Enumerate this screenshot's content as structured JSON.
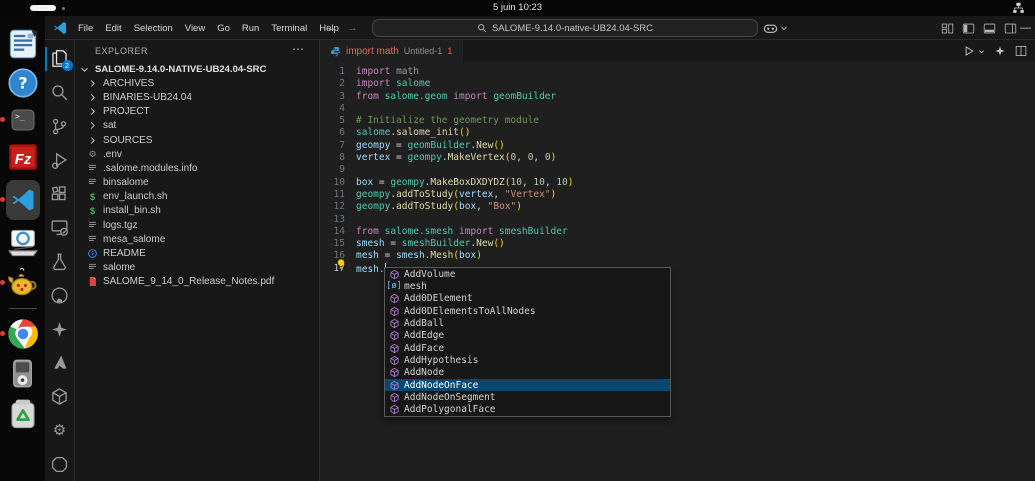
{
  "system": {
    "clock": "5 juin 10:23"
  },
  "colors": {
    "accent": "#0078d4",
    "list_selection": "#094771",
    "error": "#e5695f"
  },
  "dock": {
    "items": [
      {
        "name": "libreoffice-writer"
      },
      {
        "name": "help"
      },
      {
        "name": "terminal",
        "notification": true
      },
      {
        "name": "filezilla"
      },
      {
        "name": "vscode",
        "notification": true,
        "active": true
      },
      {
        "name": "cad-viewer"
      },
      {
        "name": "teapot-app",
        "notification": true
      },
      {
        "type": "separator"
      },
      {
        "name": "chrome",
        "notification": true
      },
      {
        "name": "media-player"
      },
      {
        "name": "trash"
      }
    ]
  },
  "titlebar": {
    "menus": [
      "File",
      "Edit",
      "Selection",
      "View",
      "Go",
      "Run",
      "Terminal",
      "Help"
    ],
    "search_value": "SALOME-9.14.0-native-UB24.04-SRC",
    "minimize_glyph": "—"
  },
  "activity_bar": {
    "items": [
      {
        "name": "explorer",
        "active": true,
        "badge": "2"
      },
      {
        "name": "search"
      },
      {
        "name": "source-control"
      },
      {
        "name": "run-debug"
      },
      {
        "name": "extensions"
      },
      {
        "name": "remote-explorer"
      },
      {
        "name": "testing"
      },
      {
        "name": "github"
      },
      {
        "name": "copilot"
      },
      {
        "name": "azure"
      },
      {
        "name": "cube"
      },
      {
        "name": "gear"
      },
      {
        "name": "octagon"
      }
    ]
  },
  "explorer": {
    "header": "EXPLORER",
    "more_actions": "⋯",
    "root": "SALOME-9.14.0-NATIVE-UB24.04-SRC",
    "items": [
      {
        "label": "ARCHIVES",
        "kind": "folder"
      },
      {
        "label": "BINARIES-UB24.04",
        "kind": "folder"
      },
      {
        "label": "PROJECT",
        "kind": "folder"
      },
      {
        "label": "sat",
        "kind": "folder"
      },
      {
        "label": "SOURCES",
        "kind": "folder"
      },
      {
        "label": ".env",
        "kind": "gear"
      },
      {
        "label": ".salome.modules.info",
        "kind": "file"
      },
      {
        "label": "binsalome",
        "kind": "file"
      },
      {
        "label": "env_launch.sh",
        "kind": "shell"
      },
      {
        "label": "install_bin.sh",
        "kind": "shell"
      },
      {
        "label": "logs.tgz",
        "kind": "file"
      },
      {
        "label": "mesa_salome",
        "kind": "file"
      },
      {
        "label": "README",
        "kind": "info"
      },
      {
        "label": "salome",
        "kind": "file"
      },
      {
        "label": "SALOME_9_14_0_Release_Notes.pdf",
        "kind": "pdf"
      }
    ]
  },
  "editor": {
    "tab": {
      "label": "import math",
      "description": "Untitled-1",
      "error_count": "1"
    },
    "code": {
      "token_colors": {
        "kw": "#C586C0",
        "mod": "#4EC9B0",
        "fn": "#DCDCAA",
        "var": "#9CDCFE",
        "num": "#B5CEA8",
        "str": "#CE9178",
        "cmt": "#6A9955",
        "pun": "#D4D4D4",
        "brk": "#FFD700",
        "dim": "#9a9a9a"
      },
      "lines": [
        [
          [
            "kw",
            "import"
          ],
          [
            "pun",
            " "
          ],
          [
            "dim",
            "math"
          ]
        ],
        [
          [
            "kw",
            "import"
          ],
          [
            "pun",
            " "
          ],
          [
            "mod",
            "salome"
          ]
        ],
        [
          [
            "kw",
            "from"
          ],
          [
            "pun",
            " "
          ],
          [
            "mod",
            "salome.geom"
          ],
          [
            "kw",
            " import "
          ],
          [
            "mod",
            "geomBuilder"
          ]
        ],
        [],
        [
          [
            "cmt",
            "# Initialize the geometry module"
          ]
        ],
        [
          [
            "mod",
            "salome"
          ],
          [
            "pun",
            "."
          ],
          [
            "fn",
            "salome_init"
          ],
          [
            "brk",
            "()"
          ]
        ],
        [
          [
            "var",
            "geompy"
          ],
          [
            "pun",
            " = "
          ],
          [
            "mod",
            "geomBuilder"
          ],
          [
            "pun",
            "."
          ],
          [
            "fn",
            "New"
          ],
          [
            "brk",
            "()"
          ]
        ],
        [
          [
            "var",
            "vertex"
          ],
          [
            "pun",
            " = "
          ],
          [
            "mod",
            "geompy"
          ],
          [
            "pun",
            "."
          ],
          [
            "fn",
            "MakeVertex"
          ],
          [
            "brk",
            "("
          ],
          [
            "num",
            "0"
          ],
          [
            "pun",
            ", "
          ],
          [
            "num",
            "0"
          ],
          [
            "pun",
            ", "
          ],
          [
            "num",
            "0"
          ],
          [
            "brk",
            ")"
          ]
        ],
        [],
        [
          [
            "var",
            "box"
          ],
          [
            "pun",
            " = "
          ],
          [
            "mod",
            "geompy"
          ],
          [
            "pun",
            "."
          ],
          [
            "fn",
            "MakeBoxDXDYDZ"
          ],
          [
            "brk",
            "("
          ],
          [
            "num",
            "10"
          ],
          [
            "pun",
            ", "
          ],
          [
            "num",
            "10"
          ],
          [
            "pun",
            ", "
          ],
          [
            "num",
            "10"
          ],
          [
            "brk",
            ")"
          ]
        ],
        [
          [
            "mod",
            "geompy"
          ],
          [
            "pun",
            "."
          ],
          [
            "fn",
            "addToStudy"
          ],
          [
            "brk",
            "("
          ],
          [
            "var",
            "vertex"
          ],
          [
            "pun",
            ", "
          ],
          [
            "str",
            "\"Vertex\""
          ],
          [
            "brk",
            ")"
          ]
        ],
        [
          [
            "mod",
            "geompy"
          ],
          [
            "pun",
            "."
          ],
          [
            "fn",
            "addToStudy"
          ],
          [
            "brk",
            "("
          ],
          [
            "var",
            "box"
          ],
          [
            "pun",
            ", "
          ],
          [
            "str",
            "\"Box\""
          ],
          [
            "brk",
            ")"
          ]
        ],
        [],
        [
          [
            "kw",
            "from"
          ],
          [
            "pun",
            " "
          ],
          [
            "mod",
            "salome.smesh"
          ],
          [
            "kw",
            " import "
          ],
          [
            "mod",
            "smeshBuilder"
          ]
        ],
        [
          [
            "var",
            "smesh"
          ],
          [
            "pun",
            " = "
          ],
          [
            "mod",
            "smeshBuilder"
          ],
          [
            "pun",
            "."
          ],
          [
            "fn",
            "New"
          ],
          [
            "brk",
            "()"
          ]
        ],
        [
          [
            "var",
            "mesh"
          ],
          [
            "pun",
            " = "
          ],
          [
            "var",
            "smesh"
          ],
          [
            "pun",
            "."
          ],
          [
            "fn",
            "Mesh"
          ],
          [
            "brk",
            "("
          ],
          [
            "var",
            "box"
          ],
          [
            "brk",
            ")"
          ]
        ],
        [
          [
            "var",
            "mesh"
          ],
          [
            "pun",
            "."
          ],
          [
            "cur",
            ""
          ]
        ]
      ]
    },
    "suggest": {
      "selected_index": 9,
      "items": [
        {
          "label": "AddVolume",
          "kind": "method"
        },
        {
          "label": "mesh",
          "kind": "variable"
        },
        {
          "label": "Add0DElement",
          "kind": "method"
        },
        {
          "label": "Add0DElementsToAllNodes",
          "kind": "method"
        },
        {
          "label": "AddBall",
          "kind": "method"
        },
        {
          "label": "AddEdge",
          "kind": "method"
        },
        {
          "label": "AddFace",
          "kind": "method"
        },
        {
          "label": "AddHypothesis",
          "kind": "method"
        },
        {
          "label": "AddNode",
          "kind": "method"
        },
        {
          "label": "AddNodeOnFace",
          "kind": "method"
        },
        {
          "label": "AddNodeOnSegment",
          "kind": "method"
        },
        {
          "label": "AddPolygonalFace",
          "kind": "method"
        }
      ]
    }
  }
}
